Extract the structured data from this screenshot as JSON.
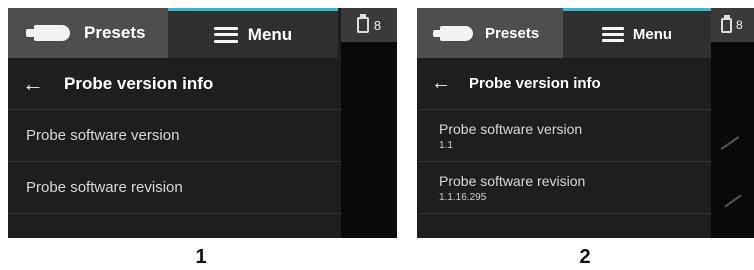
{
  "screens": [
    {
      "tabs": {
        "presets_label": "Presets",
        "menu_label": "Menu"
      },
      "battery": {
        "count": "8"
      },
      "header": {
        "back_glyph": "←",
        "title": "Probe version info"
      },
      "items": [
        {
          "label": "Probe software version",
          "value": ""
        },
        {
          "label": "Probe software revision",
          "value": ""
        }
      ],
      "caption": "1"
    },
    {
      "tabs": {
        "presets_label": "Presets",
        "menu_label": "Menu"
      },
      "battery": {
        "count": "8"
      },
      "header": {
        "back_glyph": "←",
        "title": "Probe version info"
      },
      "items": [
        {
          "label": "Probe software version",
          "value": "1.1"
        },
        {
          "label": "Probe software revision",
          "value": "1.1.16.295"
        }
      ],
      "caption": "2"
    }
  ],
  "colors": {
    "accent": "#3ab9c8",
    "background": "#1e1e1e",
    "tab_active": "#4e4e4e"
  },
  "icons": {
    "presets": "probe-icon",
    "menu": "hamburger-icon",
    "battery": "battery-icon",
    "back": "back-arrow-icon"
  }
}
